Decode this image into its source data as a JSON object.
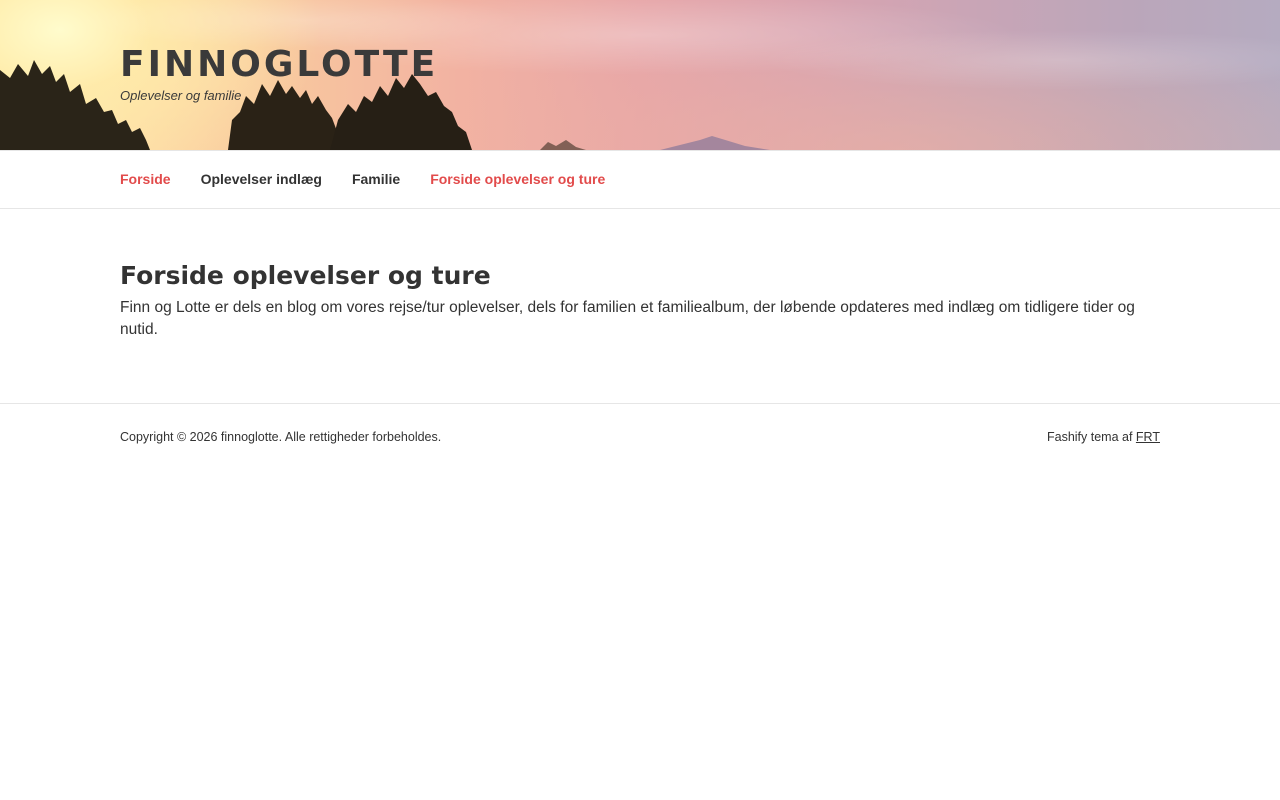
{
  "header": {
    "site_title": "FINNOGLOTTE",
    "site_description": "Oplevelser og familie"
  },
  "nav": {
    "items": [
      {
        "label": "Forside",
        "active": true
      },
      {
        "label": "Oplevelser indlæg",
        "active": false
      },
      {
        "label": "Familie",
        "active": false
      },
      {
        "label": "Forside oplevelser og ture",
        "active": true
      }
    ]
  },
  "main": {
    "title": "Forside oplevelser og ture",
    "text": "Finn og Lotte er dels en blog om vores rejse/tur oplevelser, dels for familien et familiealbum, der løbende opdateres med indlæg om tidligere tider og nutid."
  },
  "footer": {
    "copyright": "Copyright © 2026 finnoglotte. Alle rettigheder forbeholdes.",
    "theme_prefix": "Fashify tema af",
    "theme_link": "FRT"
  },
  "colors": {
    "accent": "#e24b4b",
    "text": "#333333",
    "border": "#e6e6e6"
  }
}
